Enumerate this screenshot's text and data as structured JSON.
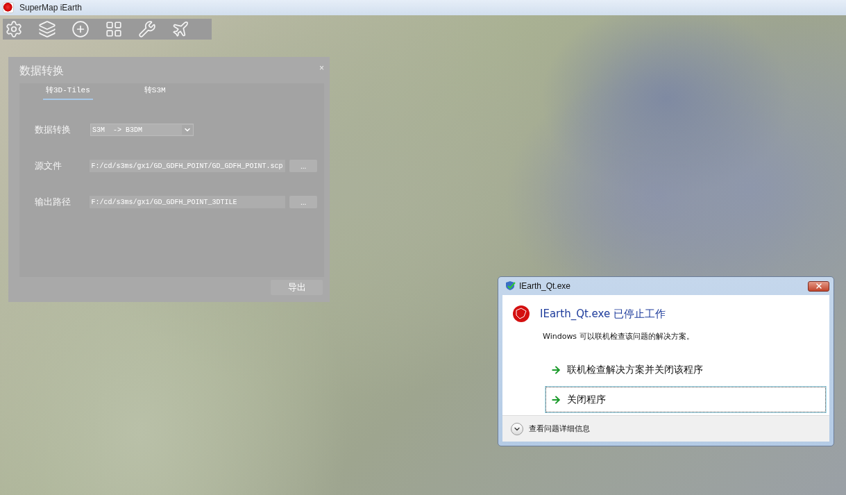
{
  "window": {
    "title": "SuperMap iEarth"
  },
  "panel": {
    "title": "数据转换",
    "close": "×",
    "tabs": [
      {
        "label": "转3D-Tiles",
        "selected": true
      },
      {
        "label": "转S3M",
        "selected": false
      }
    ],
    "fields": [
      {
        "kind": "select",
        "label": "数据转换",
        "value": "S3M  -> B3DM"
      },
      {
        "kind": "path",
        "label": "源文件",
        "value": "F:/cd/s3ms/gx1/GD_GDFH_POINT/GD_GDFH_POINT.scp",
        "browse": "..."
      },
      {
        "kind": "path",
        "label": "输出路径",
        "value": "F:/cd/s3ms/gx1/GD_GDFH_POINT_3DTILE",
        "browse": "..."
      }
    ],
    "export_button": "导出"
  },
  "error_dialog": {
    "title": "IEarth_Qt.exe",
    "heading": "IEarth_Qt.exe 已停止工作",
    "message": "Windows 可以联机检查该问题的解决方案。",
    "options": [
      {
        "label": "联机检查解决方案并关闭该程序",
        "selected": false
      },
      {
        "label": "关闭程序",
        "selected": true
      }
    ],
    "details": "查看问题详细信息"
  }
}
